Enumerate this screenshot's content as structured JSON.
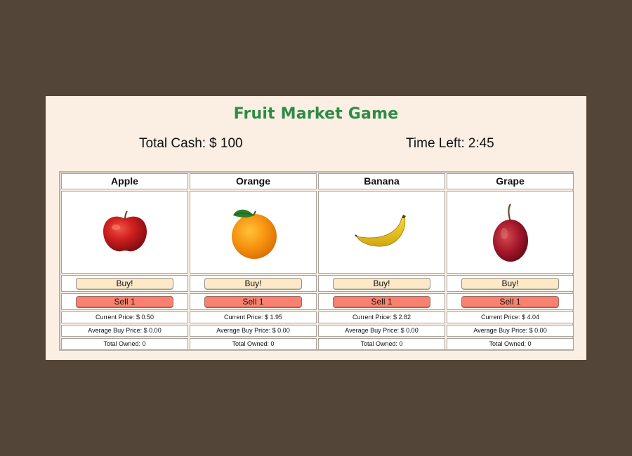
{
  "game": {
    "title": "Fruit Market Game",
    "cash_label": "Total Cash:",
    "cash_value": "$ 100",
    "time_label": "Time Left:",
    "time_value": "2:45"
  },
  "labels": {
    "buy": "Buy!",
    "sell": "Sell 1"
  },
  "fruits": [
    {
      "name": "Apple",
      "icon": "apple-image",
      "current_price": "Current Price: $ 0.50",
      "avg_price": "Average Buy Price: $ 0.00",
      "owned": "Total Owned: 0"
    },
    {
      "name": "Orange",
      "icon": "orange-image",
      "current_price": "Current Price: $ 1.95",
      "avg_price": "Average Buy Price: $ 0.00",
      "owned": "Total Owned: 0"
    },
    {
      "name": "Banana",
      "icon": "banana-image",
      "current_price": "Current Price: $ 2.82",
      "avg_price": "Average Buy Price: $ 0.00",
      "owned": "Total Owned: 0"
    },
    {
      "name": "Grape",
      "icon": "grape-image",
      "current_price": "Current Price: $ 4.04",
      "avg_price": "Average Buy Price: $ 0.00",
      "owned": "Total Owned: 0"
    }
  ],
  "colors": {
    "background": "#534537",
    "panel": "#faefe2",
    "title": "#2e8b48",
    "buy_button": "#fde8c8",
    "sell_button": "#f8826f"
  }
}
